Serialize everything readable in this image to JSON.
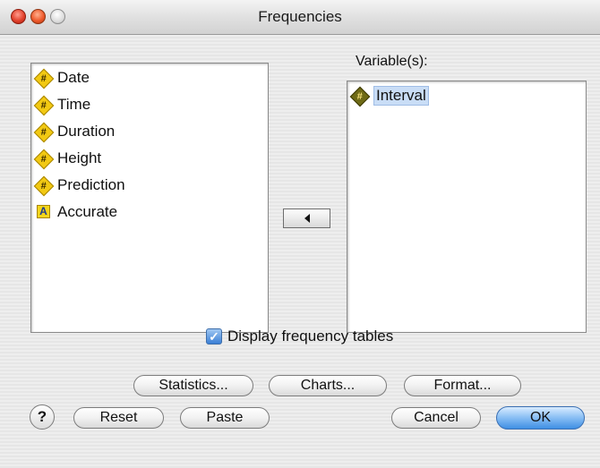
{
  "window": {
    "title": "Frequencies"
  },
  "source_list": {
    "items": [
      {
        "label": "Date",
        "type": "numeric",
        "icon": "numeric-variable-icon"
      },
      {
        "label": "Time",
        "type": "numeric",
        "icon": "numeric-variable-icon"
      },
      {
        "label": "Duration",
        "type": "numeric",
        "icon": "numeric-variable-icon"
      },
      {
        "label": "Height",
        "type": "numeric",
        "icon": "numeric-variable-icon"
      },
      {
        "label": "Prediction",
        "type": "numeric",
        "icon": "numeric-variable-icon"
      },
      {
        "label": "Accurate",
        "type": "string",
        "icon": "string-variable-icon"
      }
    ]
  },
  "target_list": {
    "label": "Variable(s):",
    "items": [
      {
        "label": "Interval",
        "type": "numeric",
        "icon": "numeric-variable-icon",
        "selected": true
      }
    ]
  },
  "icons": {
    "numeric_glyph": "#",
    "string_glyph": "A",
    "check_glyph": "✓",
    "help_glyph": "?"
  },
  "options": {
    "display_frequency_tables": {
      "label": "Display frequency tables",
      "checked": true
    }
  },
  "buttons": {
    "statistics": "Statistics...",
    "charts": "Charts...",
    "format": "Format...",
    "reset": "Reset",
    "paste": "Paste",
    "cancel": "Cancel",
    "ok": "OK"
  },
  "colors": {
    "default_button": "#3f8fe4",
    "numeric_icon": "#f2c912",
    "selection": "#c9ddf6"
  }
}
